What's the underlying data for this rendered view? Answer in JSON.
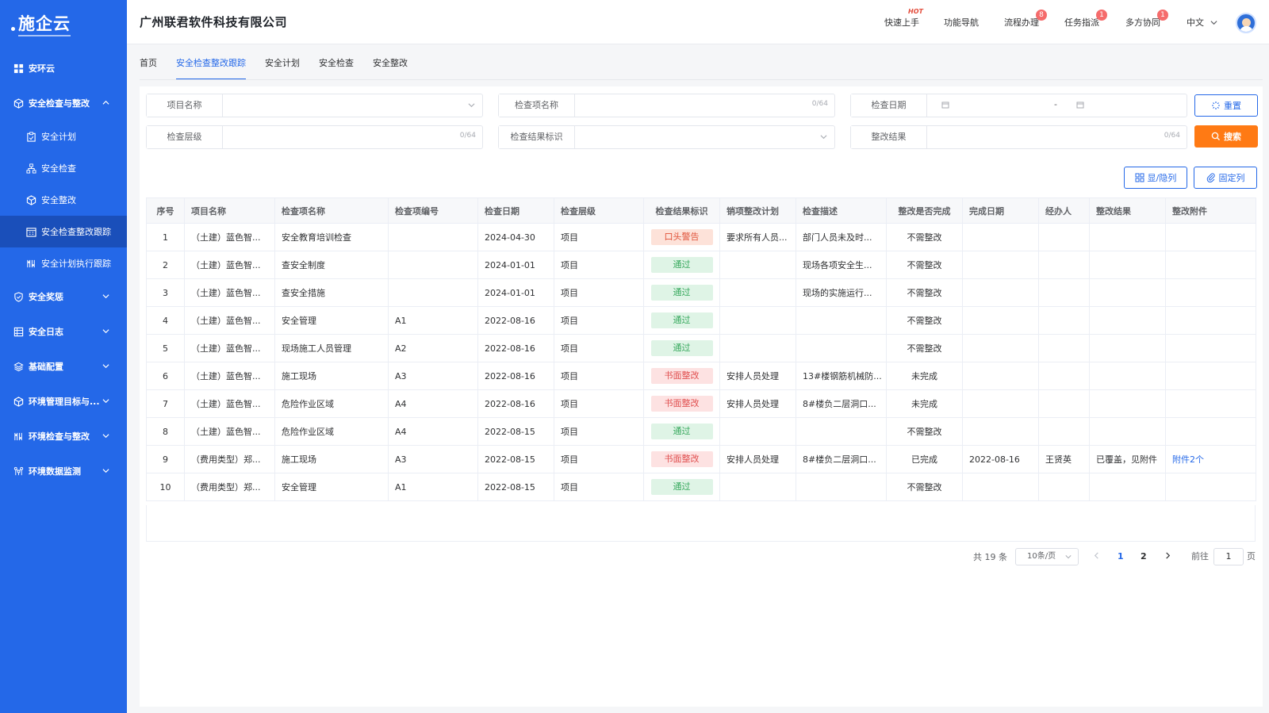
{
  "brand": {
    "logo_text": "施企云"
  },
  "header": {
    "company": "广州联君软件科技有限公司",
    "nav": [
      {
        "label": "快速上手",
        "hot": "HOT"
      },
      {
        "label": "功能导航"
      },
      {
        "label": "流程办理",
        "badge": "8"
      },
      {
        "label": "任务指派",
        "badge": "1"
      },
      {
        "label": "多方协同",
        "badge": "1"
      }
    ],
    "language": "中文"
  },
  "sidebar": {
    "items": [
      {
        "label": "安环云",
        "icon": "grid-icon"
      },
      {
        "label": "安全检查与整改",
        "icon": "cube-icon",
        "expanded": true
      },
      {
        "label": "安全计划",
        "icon": "clipboard-icon"
      },
      {
        "label": "安全检查",
        "icon": "org-chart-icon"
      },
      {
        "label": "安全整改",
        "icon": "cube-icon"
      },
      {
        "label": "安全检查整改跟踪",
        "icon": "calendar-icon",
        "active": true
      },
      {
        "label": "安全计划执行跟踪",
        "icon": "plan-icon"
      },
      {
        "label": "安全奖惩",
        "icon": "shield-icon"
      },
      {
        "label": "安全日志",
        "icon": "log-icon"
      },
      {
        "label": "基础配置",
        "icon": "layers-icon"
      },
      {
        "label": "环境管理目标与...",
        "icon": "cube-icon"
      },
      {
        "label": "环境检查与整改",
        "icon": "plan-icon"
      },
      {
        "label": "环境数据监测",
        "icon": "network-icon"
      }
    ]
  },
  "tabs": [
    "首页",
    "安全检查整改跟踪",
    "安全计划",
    "安全检查",
    "安全整改"
  ],
  "filters": {
    "project_name": {
      "label": "项目名称"
    },
    "item_name": {
      "label": "检查项名称",
      "count": "0/64"
    },
    "check_date": {
      "label": "检查日期",
      "sep": "-"
    },
    "check_level": {
      "label": "检查层级",
      "count": "0/64"
    },
    "result_mark": {
      "label": "检查结果标识"
    },
    "rectify_result": {
      "label": "整改结果",
      "count": "0/64"
    },
    "reset_label": "重置",
    "search_label": "搜索"
  },
  "toolbar": {
    "toggle_cols": "显/隐列",
    "pin_cols": "固定列"
  },
  "table": {
    "columns": [
      "序号",
      "项目名称",
      "检查项名称",
      "检查项编号",
      "检查日期",
      "检查层级",
      "检查结果标识",
      "销项整改计划",
      "检查描述",
      "整改是否完成",
      "完成日期",
      "经办人",
      "整改结果",
      "整改附件"
    ],
    "rows": [
      {
        "no": "1",
        "project": "（土建）蓝色智...",
        "item": "安全教育培训检查",
        "code": "",
        "date": "2024-04-30",
        "level": "项目",
        "mark": "口头警告",
        "mark_type": "warn",
        "plan": "要求所有人员...",
        "desc": "部门人员未及时...",
        "done": "不需整改",
        "done_date": "",
        "handler": "",
        "result": "",
        "attach": ""
      },
      {
        "no": "2",
        "project": "（土建）蓝色智...",
        "item": "查安全制度",
        "code": "",
        "date": "2024-01-01",
        "level": "项目",
        "mark": "通过",
        "mark_type": "pass",
        "plan": "",
        "desc": "现场各项安全生...",
        "done": "不需整改",
        "done_date": "",
        "handler": "",
        "result": "",
        "attach": ""
      },
      {
        "no": "3",
        "project": "（土建）蓝色智...",
        "item": "查安全措施",
        "code": "",
        "date": "2024-01-01",
        "level": "项目",
        "mark": "通过",
        "mark_type": "pass",
        "plan": "",
        "desc": "现场的实施运行...",
        "done": "不需整改",
        "done_date": "",
        "handler": "",
        "result": "",
        "attach": ""
      },
      {
        "no": "4",
        "project": "（土建）蓝色智...",
        "item": "安全管理",
        "code": "A1",
        "date": "2022-08-16",
        "level": "项目",
        "mark": "通过",
        "mark_type": "pass",
        "plan": "",
        "desc": "",
        "done": "不需整改",
        "done_date": "",
        "handler": "",
        "result": "",
        "attach": ""
      },
      {
        "no": "5",
        "project": "（土建）蓝色智...",
        "item": "现场施工人员管理",
        "code": "A2",
        "date": "2022-08-16",
        "level": "项目",
        "mark": "通过",
        "mark_type": "pass",
        "plan": "",
        "desc": "",
        "done": "不需整改",
        "done_date": "",
        "handler": "",
        "result": "",
        "attach": ""
      },
      {
        "no": "6",
        "project": "（土建）蓝色智...",
        "item": "施工现场",
        "code": "A3",
        "date": "2022-08-16",
        "level": "项目",
        "mark": "书面整改",
        "mark_type": "rect",
        "plan": "安排人员处理",
        "desc": "13#楼钢筋机械防...",
        "done": "未完成",
        "done_date": "",
        "handler": "",
        "result": "",
        "attach": ""
      },
      {
        "no": "7",
        "project": "（土建）蓝色智...",
        "item": "危险作业区域",
        "code": "A4",
        "date": "2022-08-16",
        "level": "项目",
        "mark": "书面整改",
        "mark_type": "rect",
        "plan": "安排人员处理",
        "desc": "8#楼负二层洞口...",
        "done": "未完成",
        "done_date": "",
        "handler": "",
        "result": "",
        "attach": ""
      },
      {
        "no": "8",
        "project": "（土建）蓝色智...",
        "item": "危险作业区域",
        "code": "A4",
        "date": "2022-08-15",
        "level": "项目",
        "mark": "通过",
        "mark_type": "pass",
        "plan": "",
        "desc": "",
        "done": "不需整改",
        "done_date": "",
        "handler": "",
        "result": "",
        "attach": ""
      },
      {
        "no": "9",
        "project": "（费用类型）郑...",
        "item": "施工现场",
        "code": "A3",
        "date": "2022-08-15",
        "level": "项目",
        "mark": "书面整改",
        "mark_type": "rect",
        "plan": "安排人员处理",
        "desc": "8#楼负二层洞口...",
        "done": "已完成",
        "done_date": "2022-08-16",
        "handler": "王贤英",
        "result": "已覆盖，见附件",
        "attach": "附件2个"
      },
      {
        "no": "10",
        "project": "（费用类型）郑...",
        "item": "安全管理",
        "code": "A1",
        "date": "2022-08-15",
        "level": "项目",
        "mark": "通过",
        "mark_type": "pass",
        "plan": "",
        "desc": "",
        "done": "不需整改",
        "done_date": "",
        "handler": "",
        "result": "",
        "attach": ""
      }
    ]
  },
  "pagination": {
    "total": "共 19 条",
    "page_size": "10条/页",
    "pages": [
      "1",
      "2"
    ],
    "current": "1",
    "goto_label": "前往",
    "goto_value": "1",
    "page_unit": "页"
  },
  "colors": {
    "primary": "#2468e8",
    "accent": "#ff7a14",
    "sidebar_active": "#1a4fba"
  }
}
